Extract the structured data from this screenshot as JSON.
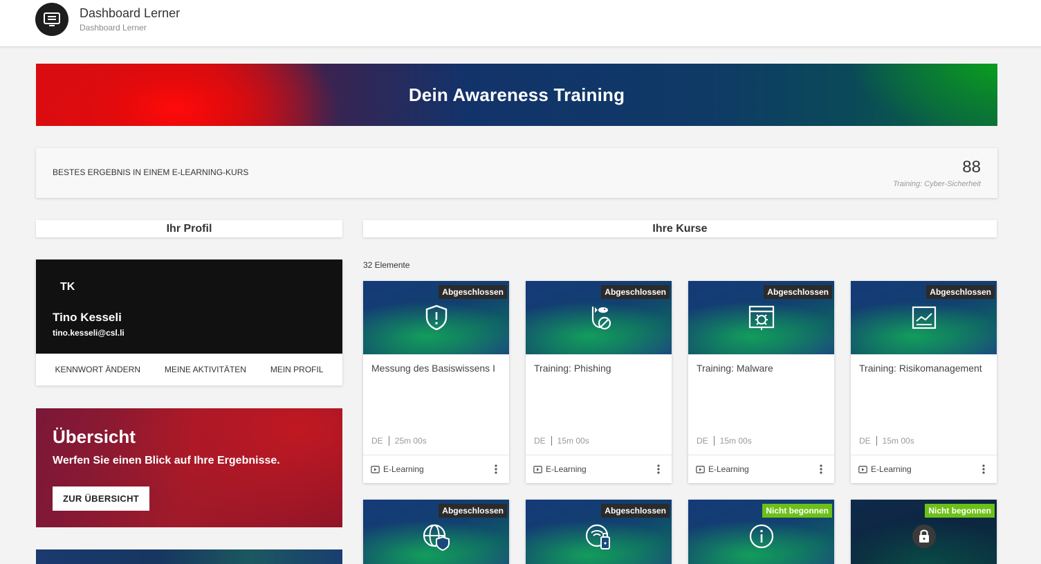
{
  "header": {
    "title": "Dashboard Lerner",
    "breadcrumb": "Dashboard Lerner",
    "icon": "dashboard-icon"
  },
  "hero": {
    "title": "Dein Awareness Training"
  },
  "best_result": {
    "label": "BESTES ERGEBNIS IN EINEM E-LEARNING-KURS",
    "score": "88",
    "course": "Training: Cyber-Sicherheit"
  },
  "profile_section": {
    "title": "Ihr Profil"
  },
  "courses_section": {
    "title": "Ihre Kurse",
    "count": "32 Elemente"
  },
  "profile": {
    "initials": "TK",
    "name": "Tino Kesseli",
    "email": "tino.kesseli@csl.li",
    "links": [
      "KENNWORT ÄNDERN",
      "MEINE AKTIVITÄTEN",
      "MEIN PROFIL"
    ]
  },
  "overview": {
    "title": "Übersicht",
    "text": "Werfen Sie einen Blick auf Ihre Ergebnisse.",
    "button": "ZUR ÜBERSICHT"
  },
  "courses": [
    {
      "status": "Abgeschlossen",
      "title": "Messung des Basiswissens I",
      "lang": "DE",
      "duration": "25m 00s",
      "type": "E-Learning",
      "icon": "shield-alert-icon"
    },
    {
      "status": "Abgeschlossen",
      "title": "Training: Phishing",
      "lang": "DE",
      "duration": "15m 00s",
      "type": "E-Learning",
      "icon": "phishing-hook-icon"
    },
    {
      "status": "Abgeschlossen",
      "title": "Training: Malware",
      "lang": "DE",
      "duration": "15m 00s",
      "type": "E-Learning",
      "icon": "malware-bug-icon"
    },
    {
      "status": "Abgeschlossen",
      "title": "Training: Risikomanagement",
      "lang": "DE",
      "duration": "15m 00s",
      "type": "E-Learning",
      "icon": "risk-chart-icon"
    },
    {
      "status": "Abgeschlossen",
      "icon": "globe-shield-icon"
    },
    {
      "status": "Abgeschlossen",
      "icon": "wifi-usb-icon"
    },
    {
      "status": "Nicht begonnen",
      "icon": "info-circle-icon"
    },
    {
      "status": "Nicht begonnen",
      "icon": "lock-icon"
    }
  ],
  "colors": {
    "badge_done": "#2b2b2b",
    "badge_not_started": "#6cc017",
    "profile_header": "#111111",
    "overview_red": "#a01a2a"
  }
}
